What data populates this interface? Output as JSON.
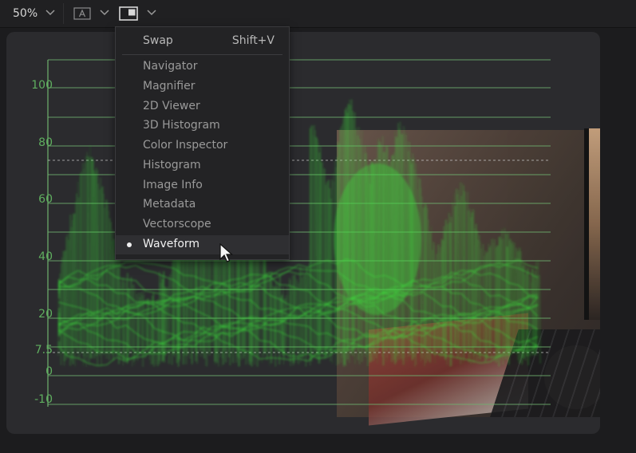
{
  "toolbar": {
    "zoom_label": "50%"
  },
  "menu": {
    "swap": {
      "label": "Swap",
      "shortcut": "Shift+V"
    },
    "items": [
      {
        "label": "Navigator"
      },
      {
        "label": "Magnifier"
      },
      {
        "label": "2D Viewer"
      },
      {
        "label": "3D Histogram"
      },
      {
        "label": "Color Inspector"
      },
      {
        "label": "Histogram"
      },
      {
        "label": "Image Info"
      },
      {
        "label": "Metadata"
      },
      {
        "label": "Vectorscope"
      },
      {
        "label": "Waveform",
        "selected": true
      }
    ]
  },
  "scope": {
    "scale_labels": [
      "100",
      "80",
      "60",
      "40",
      "20",
      "7.5",
      "0",
      "-10"
    ],
    "trace_color": "#3ce23c",
    "grid_color": "#6fb26f"
  }
}
